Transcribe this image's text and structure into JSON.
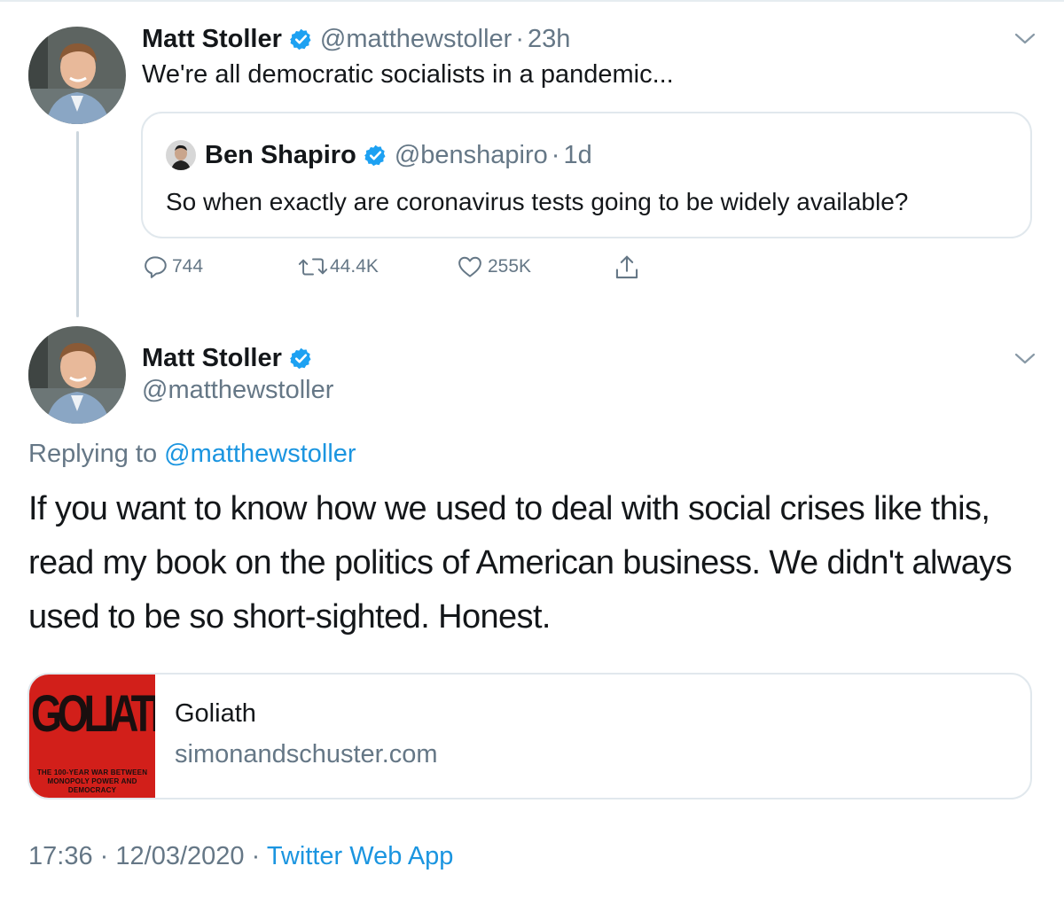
{
  "tweet1": {
    "author_name": "Matt Stoller",
    "author_handle": "@matthewstoller",
    "separator": "·",
    "time_ago": "23h",
    "text": "We're all democratic socialists in a pandemic...",
    "quoted": {
      "author_name": "Ben Shapiro",
      "author_handle": "@benshapiro",
      "separator": "·",
      "time_ago": "1d",
      "text": "So when exactly are coronavirus tests going to be widely available?"
    },
    "actions": {
      "replies": "744",
      "retweets": "44.4K",
      "likes": "255K"
    }
  },
  "tweet2": {
    "author_name": "Matt Stoller",
    "author_handle": "@matthewstoller",
    "replying_prefix": "Replying to",
    "replying_handle": "@matthewstoller",
    "text": "If you want to know how we used to deal with social crises like this, read my book on the politics of American business. We didn't always used to be so short-sighted. Honest.",
    "card": {
      "image_title": "GOLIATH",
      "image_subtitle": "THE 100-YEAR WAR BETWEEN MONOPOLY POWER AND DEMOCRACY",
      "title": "Goliath",
      "domain": "simonandschuster.com"
    },
    "meta": {
      "time": "17:36",
      "sep1": "·",
      "date": "12/03/2020",
      "sep2": "·",
      "source": "Twitter Web App"
    }
  },
  "icons": {
    "verified": "verified-badge-icon",
    "caret": "chevron-down-icon",
    "reply": "reply-icon",
    "retweet": "retweet-icon",
    "like": "heart-icon",
    "share": "share-icon"
  },
  "colors": {
    "brand_blue": "#1da1f2",
    "link_blue": "#1b95e0",
    "muted_gray": "#657786",
    "border": "#e1e8ed",
    "text": "#14171a",
    "book_red": "#d21f1a"
  }
}
